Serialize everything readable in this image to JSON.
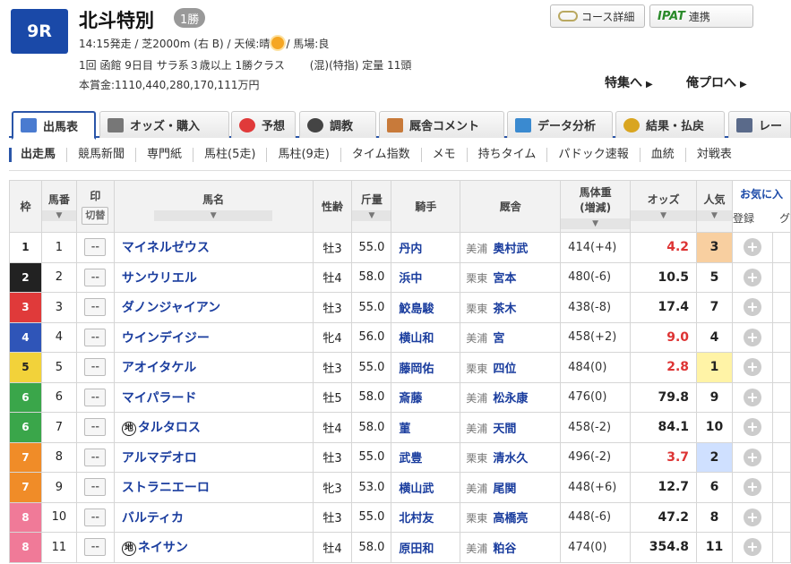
{
  "race": {
    "number": "9R",
    "title": "北斗特別",
    "class_badge": "1勝",
    "line1_pre": "14:15発走 / 芝2000m (右 B) / 天候:晴",
    "line1_post": "/ 馬場:良",
    "line2": "1回 函館 9日目 サラ系３歳以上 1勝クラス　　 (混)(特指) 定量 11頭",
    "line3": "本賞金:1110,440,280,170,111万円"
  },
  "buttons": {
    "course": "コース詳細",
    "ipat_logo": "IPAT",
    "ipat": "連携"
  },
  "links": {
    "feature": "特集へ",
    "pro": "俺プロへ"
  },
  "main_tabs": [
    "出馬表",
    "オッズ・購入",
    "予想",
    "調教",
    "厩舎コメント",
    "データ分析",
    "結果・払戻",
    "レー"
  ],
  "sub_tabs": [
    "出走馬",
    "競馬新聞",
    "専門紙",
    "馬柱(5走)",
    "馬柱(9走)",
    "タイム指数",
    "メモ",
    "持ちタイム",
    "パドック速報",
    "血統",
    "対戦表"
  ],
  "headers": {
    "waku": "枠",
    "umaban": "馬番",
    "mark": "印",
    "mark_toggle": "切替",
    "horse": "馬名",
    "sexage": "性齢",
    "kinryo": "斤量",
    "jockey": "騎手",
    "stable": "厩舎",
    "weight": "馬体重",
    "weight_sub": "(増減)",
    "odds": "オッズ",
    "popular": "人気",
    "fav": "お気に入",
    "fav_reg": "登録",
    "fav_g": "グ"
  },
  "mark_default": "--",
  "chi_mark": "地",
  "colors": {
    "waku1": "#ffffff",
    "waku2": "#222222",
    "waku3": "#e03a3a",
    "waku4": "#2f55b8",
    "waku5": "#f2d23a",
    "waku6": "#3aa64a",
    "waku7": "#f08c28",
    "waku8": "#f07a98",
    "pop1": "#fff3a6",
    "pop2": "#cfe0ff",
    "pop3": "#f8cfa0"
  },
  "rows": [
    {
      "waku": "1",
      "num": "1",
      "chi": false,
      "horse": "マイネルゼウス",
      "sexage": "牡3",
      "kinryo": "55.0",
      "jockey": "丹内",
      "region": "美浦",
      "trainer": "奥村武",
      "weight": "414(+4)",
      "odds": "4.2",
      "hot": true,
      "pop": "3"
    },
    {
      "waku": "2",
      "num": "2",
      "chi": false,
      "horse": "サンウリエル",
      "sexage": "牡4",
      "kinryo": "58.0",
      "jockey": "浜中",
      "region": "栗東",
      "trainer": "宮本",
      "weight": "480(-6)",
      "odds": "10.5",
      "hot": false,
      "pop": "5"
    },
    {
      "waku": "3",
      "num": "3",
      "chi": false,
      "horse": "ダノンジャイアン",
      "sexage": "牡3",
      "kinryo": "55.0",
      "jockey": "鮫島駿",
      "region": "栗東",
      "trainer": "茶木",
      "weight": "438(-8)",
      "odds": "17.4",
      "hot": false,
      "pop": "7"
    },
    {
      "waku": "4",
      "num": "4",
      "chi": false,
      "horse": "ウインデイジー",
      "sexage": "牝4",
      "kinryo": "56.0",
      "jockey": "横山和",
      "region": "美浦",
      "trainer": "宮",
      "weight": "458(+2)",
      "odds": "9.0",
      "hot": true,
      "pop": "4"
    },
    {
      "waku": "5",
      "num": "5",
      "chi": false,
      "horse": "アオイタケル",
      "sexage": "牡3",
      "kinryo": "55.0",
      "jockey": "藤岡佑",
      "region": "栗東",
      "trainer": "四位",
      "weight": "484(0)",
      "odds": "2.8",
      "hot": true,
      "pop": "1"
    },
    {
      "waku": "6",
      "num": "6",
      "chi": false,
      "horse": "マイパラード",
      "sexage": "牡5",
      "kinryo": "58.0",
      "jockey": "斎藤",
      "region": "美浦",
      "trainer": "松永康",
      "weight": "476(0)",
      "odds": "79.8",
      "hot": false,
      "pop": "9"
    },
    {
      "waku": "6",
      "num": "7",
      "chi": true,
      "horse": "タルタロス",
      "sexage": "牡4",
      "kinryo": "58.0",
      "jockey": "菫",
      "region": "美浦",
      "trainer": "天間",
      "weight": "458(-2)",
      "odds": "84.1",
      "hot": false,
      "pop": "10"
    },
    {
      "waku": "7",
      "num": "8",
      "chi": false,
      "horse": "アルマデオロ",
      "sexage": "牡3",
      "kinryo": "55.0",
      "jockey": "武豊",
      "region": "栗東",
      "trainer": "清水久",
      "weight": "496(-2)",
      "odds": "3.7",
      "hot": true,
      "pop": "2"
    },
    {
      "waku": "7",
      "num": "9",
      "chi": false,
      "horse": "ストラニエーロ",
      "sexage": "牝3",
      "kinryo": "53.0",
      "jockey": "横山武",
      "region": "美浦",
      "trainer": "尾関",
      "weight": "448(+6)",
      "odds": "12.7",
      "hot": false,
      "pop": "6"
    },
    {
      "waku": "8",
      "num": "10",
      "chi": false,
      "horse": "バルティカ",
      "sexage": "牡3",
      "kinryo": "55.0",
      "jockey": "北村友",
      "region": "栗東",
      "trainer": "高橋亮",
      "weight": "448(-6)",
      "odds": "47.2",
      "hot": false,
      "pop": "8"
    },
    {
      "waku": "8",
      "num": "11",
      "chi": true,
      "horse": "ネイサン",
      "sexage": "牡4",
      "kinryo": "58.0",
      "jockey": "原田和",
      "region": "美浦",
      "trainer": "粕谷",
      "weight": "474(0)",
      "odds": "354.8",
      "hot": false,
      "pop": "11"
    }
  ]
}
